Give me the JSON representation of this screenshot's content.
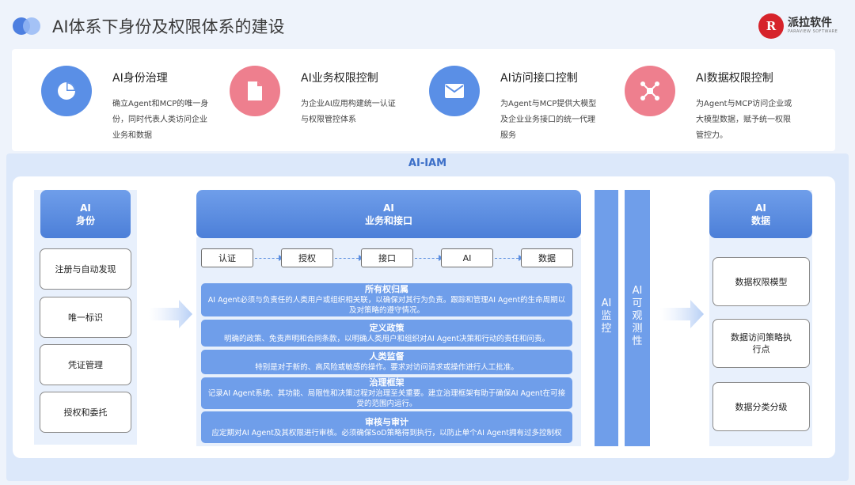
{
  "header": {
    "title": "AI体系下身份及权限体系的建设",
    "logo_mark": "R",
    "logo_name": "派拉软件",
    "logo_sub": "PARAVIEW SOFTWARE"
  },
  "cards": [
    {
      "title": "AI身份治理",
      "text": "确立Agent和MCP的唯一身份，同时代表人类访问企业业务和数据",
      "icon": "pie-chart-icon",
      "color": "#5a8fe6"
    },
    {
      "title": "AI业务权限控制",
      "text": "为企业AI应用构建统一认证与权限管控体系",
      "icon": "document-icon",
      "color": "#ee7f8e"
    },
    {
      "title": "AI访问接口控制",
      "text": "为Agent与MCP提供大模型及企业业务接口的统一代理服务",
      "icon": "mail-icon",
      "color": "#5a8fe6"
    },
    {
      "title": "AI数据权限控制",
      "text": "为Agent与MCP访问企业或大模型数据，赋予统一权限管控力。",
      "icon": "network-icon",
      "color": "#ee7f8e"
    }
  ],
  "iam": {
    "title": "AI-IAM",
    "identity": {
      "head_line1": "AI",
      "head_line2": "身份",
      "items": [
        "注册与自动发现",
        "唯一标识",
        "凭证管理",
        "授权和委托"
      ]
    },
    "business": {
      "head_line1": "AI",
      "head_line2": "业务和接口",
      "flow": [
        "认证",
        "授权",
        "接口",
        "AI",
        "数据"
      ],
      "governance": [
        {
          "title": "所有权归属",
          "text": "AI Agent必须与负责任的人类用户或组织相关联，以确保对其行为负责。跟踪和管理AI Agent的生命周期以及对策略的遵守情况。"
        },
        {
          "title": "定义政策",
          "text": "明确的政策、免责声明和合同条款，以明确人类用户和组织对AI Agent决策和行动的责任和问责。"
        },
        {
          "title": "人类监督",
          "text": "特别是对于新的、高风险或敏感的操作。要求对访问请求或操作进行人工批准。"
        },
        {
          "title": "治理框架",
          "text": "记录AI Agent系统、其功能、局限性和决策过程对治理至关重要。建立治理框架有助于确保AI Agent在可接受的范围内运行。"
        },
        {
          "title": "审核与审计",
          "text": "应定期对AI Agent及其权限进行审核。必须确保SoD策略得到执行，以防止单个AI Agent拥有过多控制权"
        }
      ]
    },
    "monitor": "AI监控",
    "observability": "AI可观测性",
    "data": {
      "head_line1": "AI",
      "head_line2": "数据",
      "items": [
        "数据权限模型",
        "数据访问策略执行点",
        "数据分类分级"
      ]
    }
  }
}
